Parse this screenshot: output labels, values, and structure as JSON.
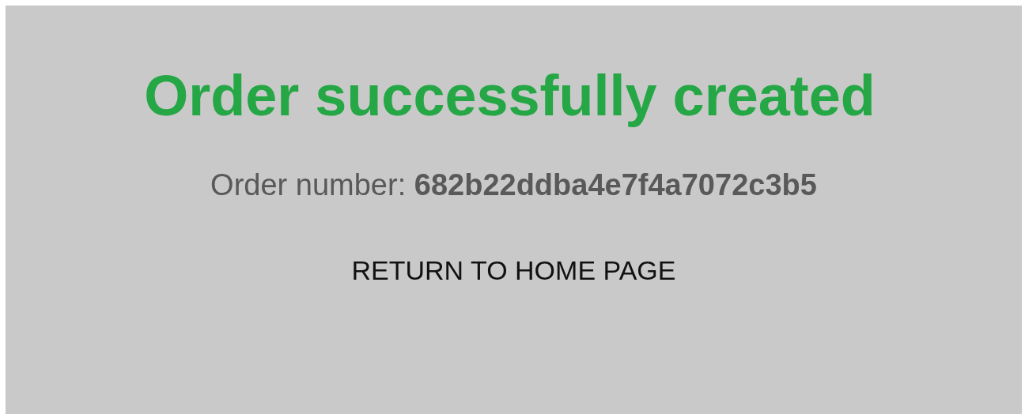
{
  "title": "Order successfully created",
  "order": {
    "label": "Order number:",
    "number": "682b22ddba4e7f4a7072c3b5"
  },
  "button": "RETURN TO HOME PAGE"
}
